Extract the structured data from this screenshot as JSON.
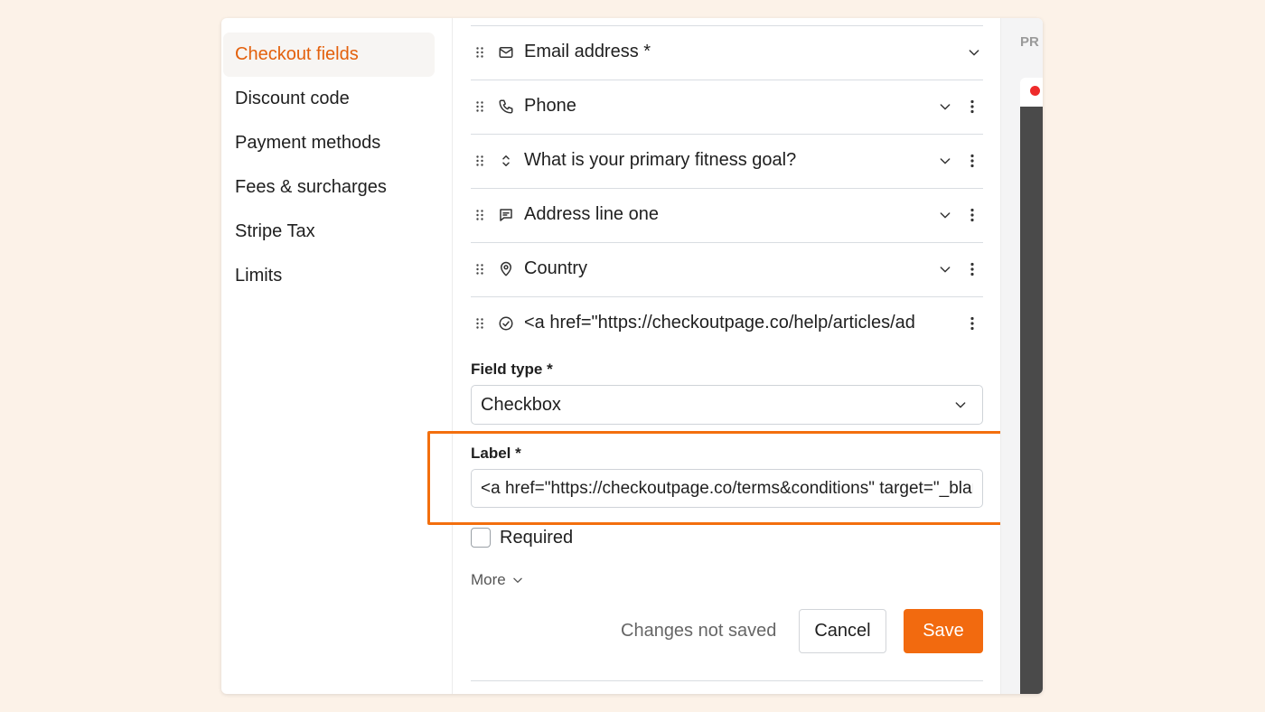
{
  "sidebar": {
    "items": [
      {
        "label": "Checkout fields",
        "active": true
      },
      {
        "label": "Discount code"
      },
      {
        "label": "Payment methods"
      },
      {
        "label": "Fees & surcharges"
      },
      {
        "label": "Stripe Tax"
      },
      {
        "label": "Limits"
      }
    ]
  },
  "fields": [
    {
      "label": "Email address *",
      "icon": "envelope-icon"
    },
    {
      "label": "Phone",
      "icon": "phone-icon"
    },
    {
      "label": "What is your primary fitness goal?",
      "icon": "select-arrows-icon"
    },
    {
      "label": "Address line one",
      "icon": "message-square-icon"
    },
    {
      "label": "Country",
      "icon": "map-pin-icon"
    },
    {
      "label": "<a href=\"https://checkoutpage.co/help/articles/ad",
      "icon": "check-circle-icon"
    }
  ],
  "editor": {
    "field_type_label": "Field type *",
    "field_type_value": "Checkbox",
    "label_label": "Label *",
    "label_value": "<a href=\"https://checkoutpage.co/terms&conditions\" target=\"_blank\">Terms and conditions</a>",
    "required_label": "Required",
    "required_checked": false,
    "more_label": "More"
  },
  "footer": {
    "status": "Changes not saved",
    "cancel": "Cancel",
    "save": "Save"
  },
  "preview": {
    "label": "PR"
  },
  "colors": {
    "accent": "#f26a0f",
    "active_nav_text": "#e3600c",
    "highlight_border": "#f36f0e",
    "status_dot": "#ee2b2b"
  }
}
